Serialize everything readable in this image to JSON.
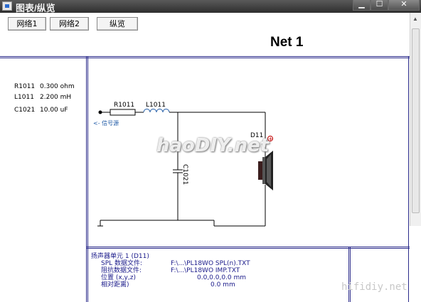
{
  "window": {
    "title": "图表/纵览",
    "minimize": "▁",
    "maximize": "☐",
    "close": "✕"
  },
  "toolbar": {
    "buttons": [
      "网络1",
      "网络2",
      "纵览"
    ]
  },
  "net_title": "Net 1",
  "components": [
    {
      "ref": "R1011",
      "value": "0.300 ohm"
    },
    {
      "ref": "L1011",
      "value": "2.200 mH"
    },
    {
      "ref": "C1021",
      "value": "10.00 uF"
    }
  ],
  "schematic": {
    "r_label": "R1011",
    "l_label": "L1011",
    "c_label": "C1021",
    "d_label": "D11",
    "plus": "+",
    "source_label": "<- 信号源"
  },
  "driver_info": {
    "heading": "扬声器单元 1 (D11)",
    "rows": [
      {
        "label": "SPL 数据文件:",
        "value": "F:\\...\\PL18WO SPL(n).TXT"
      },
      {
        "label": "阻抗数据文件:",
        "value": "F:\\...\\PL18WO IMP.TXT"
      },
      {
        "label": "位置 (x,y,z)",
        "value": "0.0,0.0,0.0 mm"
      },
      {
        "label": "相对距离)",
        "value": "0.0 mm"
      }
    ]
  },
  "watermarks": {
    "center": "haoDIY.net",
    "corner": "hifidiy.net"
  }
}
